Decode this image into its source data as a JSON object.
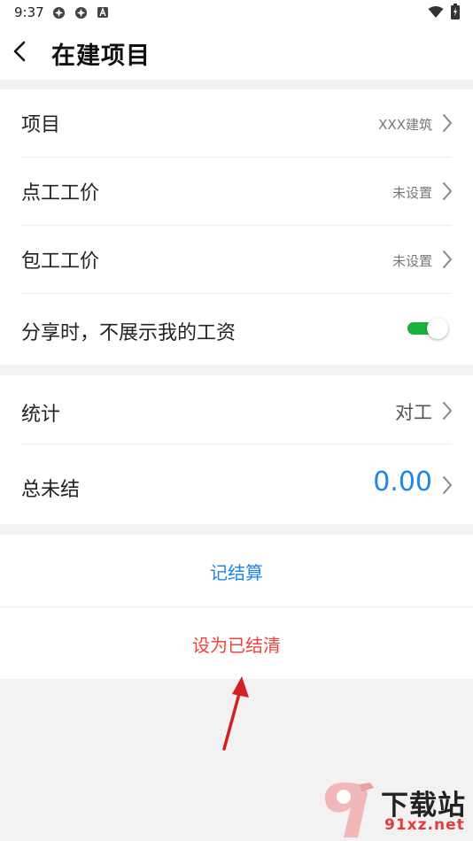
{
  "status_bar": {
    "time": "9:37",
    "icons": [
      "app-notification-icon",
      "app-notification-icon",
      "text-notification-icon",
      "wifi-icon",
      "battery-charging-icon"
    ]
  },
  "header": {
    "back_icon": "chevron-left-icon",
    "title": "在建项目"
  },
  "section1": {
    "rows": [
      {
        "label": "项目",
        "value": "XXX建筑"
      },
      {
        "label": "点工工价",
        "value": "未设置"
      },
      {
        "label": "包工工价",
        "value": "未设置"
      }
    ],
    "toggle": {
      "label": "分享时，不展示我的工资",
      "on": true
    }
  },
  "section2": {
    "stats": {
      "label": "统计",
      "value": "对工"
    },
    "unsettled": {
      "label": "总未结",
      "value": "0.00"
    }
  },
  "actions": {
    "record_settlement": "记结算",
    "mark_settled": "设为已结清"
  },
  "watermark": {
    "title": "下载站",
    "url": "91xz.net"
  },
  "colors": {
    "accent_blue": "#1e86e8",
    "danger_red": "#f0433a",
    "toggle_green": "#18b13a",
    "background": "#f2f2f2",
    "annotation_arrow": "#d42020"
  }
}
